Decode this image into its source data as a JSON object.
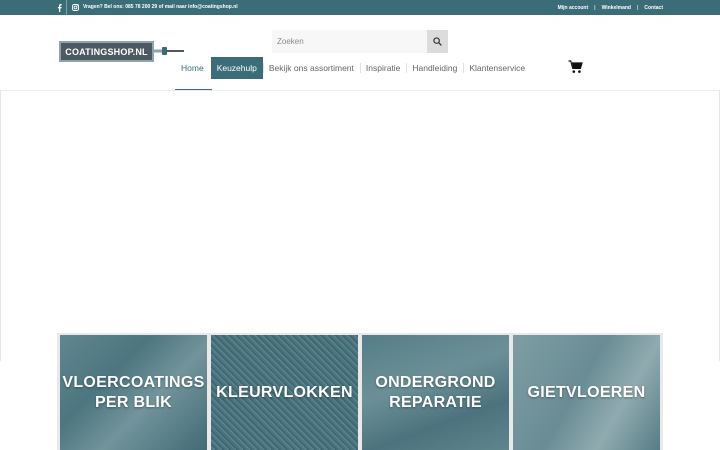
{
  "colors": {
    "brand": "#3b6d78",
    "topbar_text": "#ffffff",
    "nav_text": "#666666"
  },
  "topbar": {
    "social": [
      {
        "icon": "facebook-icon"
      },
      {
        "icon": "instagram-icon"
      }
    ],
    "contact_text": "Vragen? Bel ons: 085 78 200 29 of mail naar info@coatingshop.nl",
    "links": [
      "Mijn account",
      "Winkelmand",
      "Contact"
    ]
  },
  "logo": {
    "text": "COATINGSHOP.NL"
  },
  "search": {
    "placeholder": "Zoeken",
    "icon": "search-icon"
  },
  "nav": {
    "items": [
      "Home",
      "Keuzehulp",
      "Bekijk ons assortiment",
      "Inspiratie",
      "Handleiding",
      "Klantenservice"
    ],
    "active": "Keuzehulp",
    "current": "Home"
  },
  "cart": {
    "icon": "cart-icon"
  },
  "categories": [
    {
      "label": "VLOERCOATINGS\nPER BLIK"
    },
    {
      "label": "KLEURVLOKKEN"
    },
    {
      "label": "ONDERGROND\nREPARATIE"
    },
    {
      "label": "GIETVLOEREN"
    }
  ]
}
